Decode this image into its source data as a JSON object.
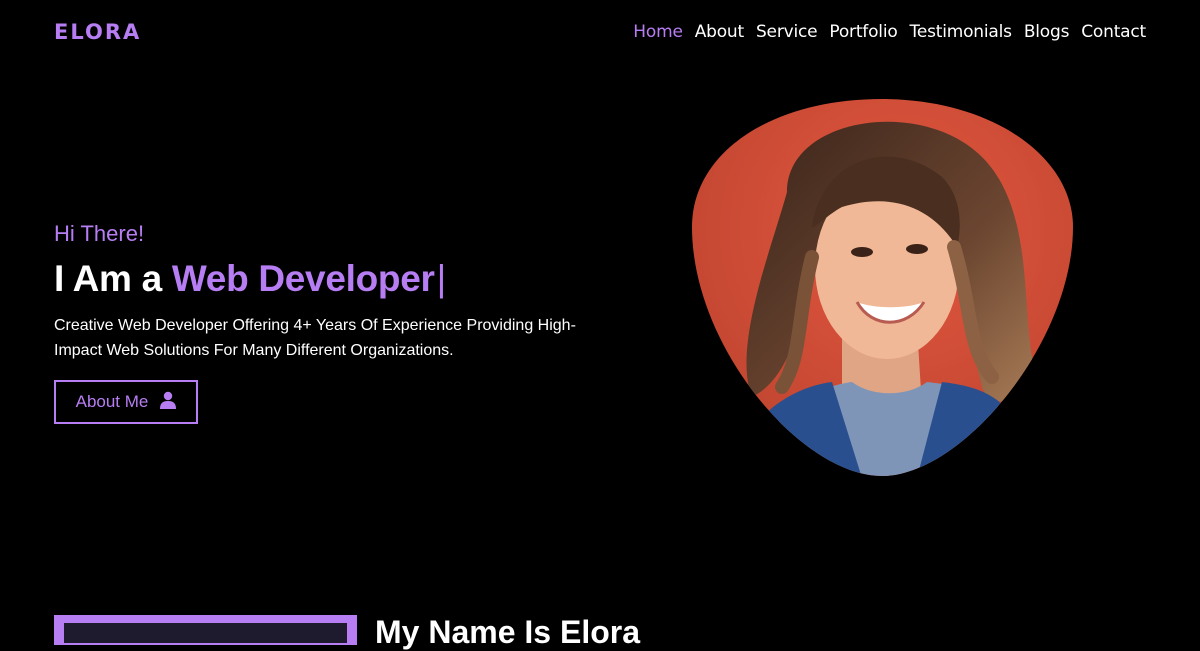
{
  "brand": {
    "logo": "ELORA",
    "accent_color": "#b77ef3"
  },
  "nav": {
    "items": [
      {
        "label": "Home",
        "active": true
      },
      {
        "label": "About"
      },
      {
        "label": "Service"
      },
      {
        "label": "Portfolio"
      },
      {
        "label": "Testimonials"
      },
      {
        "label": "Blogs"
      },
      {
        "label": "Contact"
      }
    ]
  },
  "hero": {
    "greeting": "Hi There!",
    "headline_prefix": "I Am a ",
    "role": "Web Developer",
    "cursor": "|",
    "description": "Creative Web Developer Offering 4+ Years Of Experience Providing High-Impact Web Solutions For Many Different Organizations.",
    "button_label": "About Me",
    "button_icon": "user-icon",
    "portrait_alt": "smiling woman portrait"
  },
  "about": {
    "title": "My Name Is Elora"
  }
}
